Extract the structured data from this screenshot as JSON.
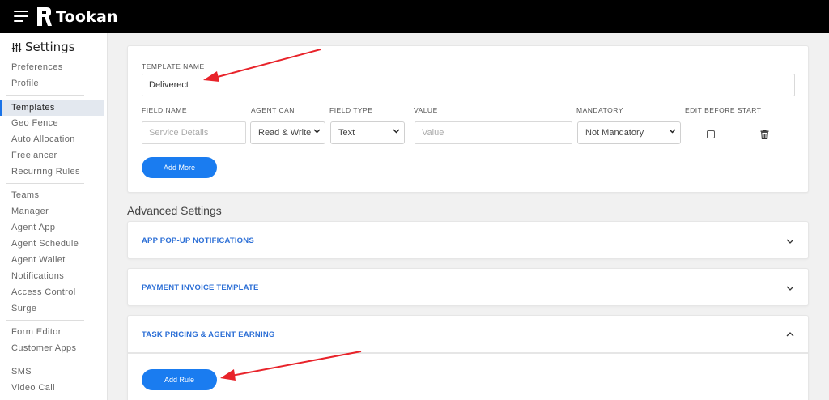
{
  "brand": {
    "name": "Tookan",
    "accent": "#1a7cf0",
    "topbar_color": "#000000"
  },
  "sidebar": {
    "title": "Settings",
    "title_icon": "sliders-icon",
    "items": [
      {
        "label": "Preferences"
      },
      {
        "label": "Profile"
      },
      {
        "label": "Templates",
        "active": true
      },
      {
        "label": "Geo Fence"
      },
      {
        "label": "Auto Allocation"
      },
      {
        "label": "Freelancer"
      },
      {
        "label": "Recurring Rules"
      },
      {
        "label": "Teams"
      },
      {
        "label": "Manager"
      },
      {
        "label": "Agent  App"
      },
      {
        "label": "Agent Schedule"
      },
      {
        "label": "Agent Wallet"
      },
      {
        "label": "Notifications"
      },
      {
        "label": "Access Control"
      },
      {
        "label": "Surge"
      },
      {
        "label": "Form Editor"
      },
      {
        "label": "Customer Apps"
      },
      {
        "label": "SMS"
      },
      {
        "label": "Video Call"
      }
    ]
  },
  "template": {
    "name_label": "TEMPLATE NAME",
    "name_value": "Deliverect",
    "headers": {
      "field_name": "FIELD NAME",
      "agent_can": "AGENT CAN",
      "field_type": "FIELD TYPE",
      "value": "VALUE",
      "mandatory": "MANDATORY",
      "edit_before_start": "EDIT BEFORE START"
    },
    "row": {
      "field_name_placeholder": "Service Details",
      "agent_can": "Read & Write",
      "field_type": "Text",
      "value_placeholder": "Value",
      "mandatory": "Not Mandatory",
      "edit_before_start": false
    },
    "add_more_label": "Add More"
  },
  "advanced": {
    "title": "Advanced Settings",
    "sections": [
      {
        "title": "APP POP-UP NOTIFICATIONS",
        "expanded": false
      },
      {
        "title": "PAYMENT INVOICE TEMPLATE",
        "expanded": false
      },
      {
        "title": "TASK PRICING & AGENT EARNING",
        "expanded": true
      }
    ],
    "add_rule_label": "Add Rule"
  },
  "annotations": {
    "arrow_color": "#e8232a"
  }
}
